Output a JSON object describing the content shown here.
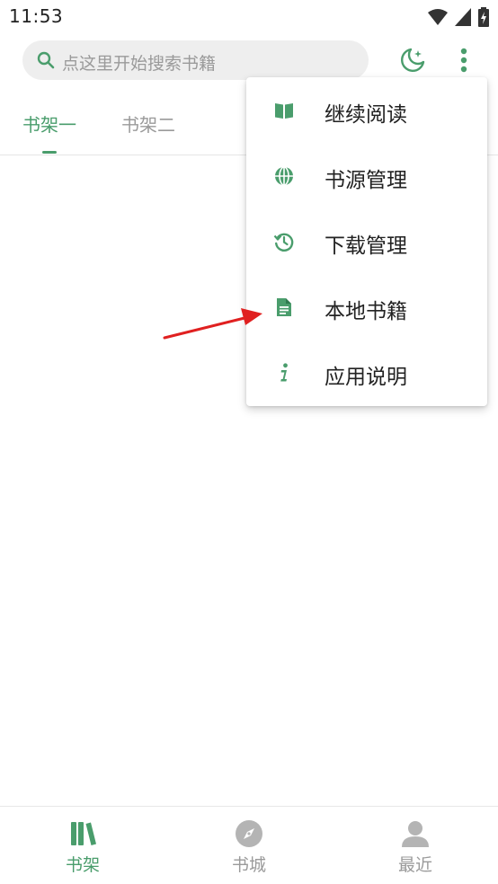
{
  "status_bar": {
    "time": "11:53"
  },
  "search": {
    "placeholder": "点这里开始搜索书籍"
  },
  "tabs": [
    {
      "label": "书架一",
      "active": true
    },
    {
      "label": "书架二",
      "active": false
    }
  ],
  "menu": {
    "items": [
      {
        "label": "继续阅读",
        "icon": "book-open-icon"
      },
      {
        "label": "书源管理",
        "icon": "globe-icon"
      },
      {
        "label": "下载管理",
        "icon": "history-icon"
      },
      {
        "label": "本地书籍",
        "icon": "document-icon"
      },
      {
        "label": "应用说明",
        "icon": "info-icon"
      }
    ]
  },
  "bottom_nav": [
    {
      "label": "书架",
      "icon": "bookshelf-icon",
      "active": true
    },
    {
      "label": "书城",
      "icon": "compass-icon",
      "active": false
    },
    {
      "label": "最近",
      "icon": "person-icon",
      "active": false
    }
  ],
  "colors": {
    "accent": "#4a9d6c",
    "inactive": "#9a9a9a",
    "annotation_arrow": "#e02020"
  }
}
